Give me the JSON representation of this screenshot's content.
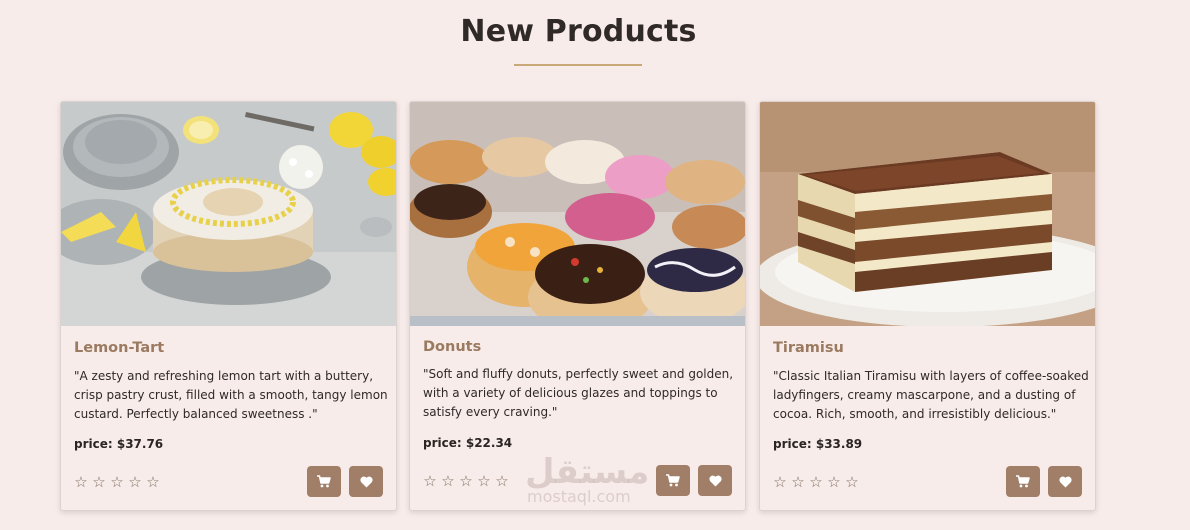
{
  "section": {
    "title": "New Products"
  },
  "products": [
    {
      "name": "Lemon-Tart",
      "description": "\"A zesty and refreshing lemon tart with a buttery, crisp pastry crust, filled with a smooth, tangy lemon custard. Perfectly balanced sweetness .\"",
      "price": "price: $37.76",
      "image_icon": "lemon-tart-photo",
      "rating": 0
    },
    {
      "name": "Donuts",
      "description": "\"Soft and fluffy donuts, perfectly sweet and golden, with a variety of delicious glazes and toppings to satisfy every craving.\"",
      "price": "price: $22.34",
      "image_icon": "donuts-photo",
      "rating": 0
    },
    {
      "name": "Tiramisu",
      "description": "\"Classic Italian Tiramisu with layers of coffee-soaked ladyfingers, creamy mascarpone, and a dusting of cocoa. Rich, smooth, and irresistibly delicious.\"",
      "price": "price: $33.89",
      "image_icon": "tiramisu-photo",
      "rating": 0
    }
  ],
  "star_glyph": "☆",
  "watermark": {
    "arabic": "مستقل",
    "latin": "mostaql.com"
  },
  "colors": {
    "background": "#f8ecea",
    "accent_button": "#a07e68",
    "product_name": "#9a7a60",
    "underline": "#c9a977"
  }
}
